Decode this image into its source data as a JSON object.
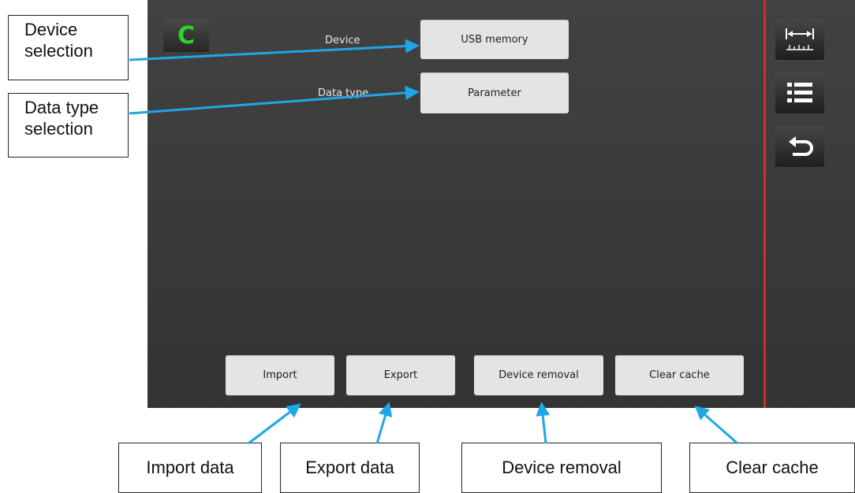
{
  "screen": {
    "logo_letter": "C",
    "device_label": "Device",
    "device_value": "USB memory",
    "datatype_label": "Data type",
    "datatype_value": "Parameter",
    "actions": {
      "import": "Import",
      "export": "Export",
      "device_removal": "Device removal",
      "clear_cache": "Clear cache"
    },
    "sidebar": {
      "icons": [
        "measure-icon",
        "list-icon",
        "back-icon"
      ]
    }
  },
  "callouts": {
    "device_selection": "Device selection",
    "datatype_selection": "Data type selection",
    "import_data": "Import data",
    "export_data": "Export data",
    "device_removal": "Device removal",
    "clear_cache": "Clear cache"
  },
  "colors": {
    "accent_red": "#d42b2b",
    "logo_green": "#2fd12f",
    "arrow_blue": "#1ea7e8"
  }
}
